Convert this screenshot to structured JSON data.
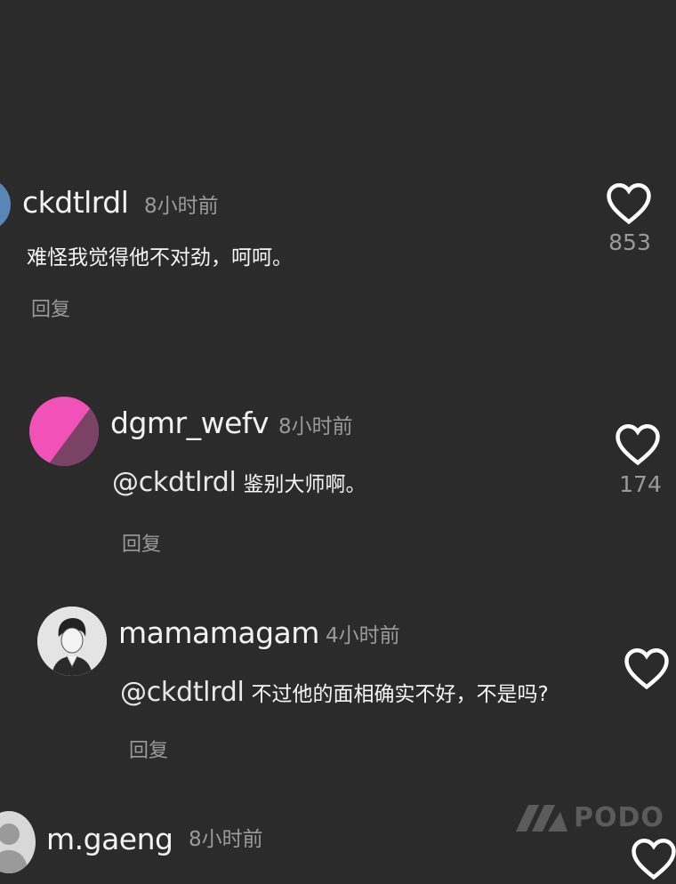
{
  "comments": [
    {
      "username": "ckdtlrdl",
      "time": "8小时前",
      "text": "难怪我觉得他不对劲，呵呵。",
      "reply_label": "回复",
      "likes": "853"
    },
    {
      "username": "dgmr_wefv",
      "time": "8小时前",
      "mention": "@ckdtlrdl",
      "text": "鉴别大师啊。",
      "reply_label": "回复",
      "likes": "174"
    },
    {
      "username": "mamamagam",
      "time": "4小时前",
      "mention": "@ckdtlrdl",
      "text": "不过他的面相确实不好，不是吗?",
      "reply_label": "回复"
    },
    {
      "username": "m.gaeng",
      "time": "8小时前"
    }
  ],
  "watermark": "PODO",
  "colors": {
    "background": "#2b2b2b",
    "avatar_pink": "#f052b8",
    "avatar_dark": "#7a4366",
    "muted_text": "#9a9a9a"
  },
  "icons": {
    "like": "heart-outline-icon",
    "watermark_logo": "podo-logo-icon"
  }
}
